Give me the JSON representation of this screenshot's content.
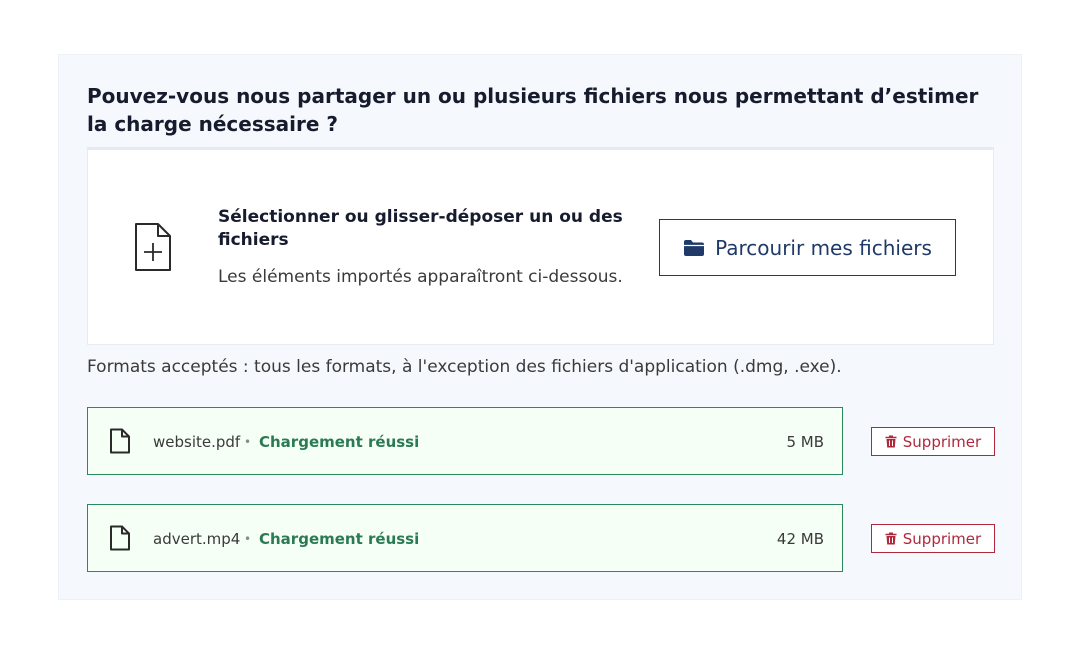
{
  "question": "Pouvez-vous nous partager un ou plusieurs fichiers nous permettant d’estimer la charge nécessaire ?",
  "dropzone": {
    "title": "Sélectionner ou glisser-déposer un ou des fichiers",
    "subtitle": "Les éléments importés apparaîtront ci-dessous.",
    "icon": "file-plus-icon",
    "browse_label": "Parcourir mes fichiers",
    "browse_icon": "folder-icon"
  },
  "formats_note": "Formats acceptés : tous les formats, à l'exception des fichiers d'application (.dmg, .exe).",
  "files": [
    {
      "name": "website.pdf",
      "separator": "•",
      "status": "Chargement réussi",
      "size": "5 MB",
      "delete_label": "Supprimer"
    },
    {
      "name": "advert.mp4",
      "separator": "•",
      "status": "Chargement réussi",
      "size": "42 MB",
      "delete_label": "Supprimer"
    }
  ],
  "colors": {
    "panel_bg": "#f5f8fc",
    "primary": "#1f3a68",
    "success": "#2b7a55",
    "success_border": "#2b8a5d",
    "success_bg": "#f5fff5",
    "danger": "#b0283c"
  }
}
